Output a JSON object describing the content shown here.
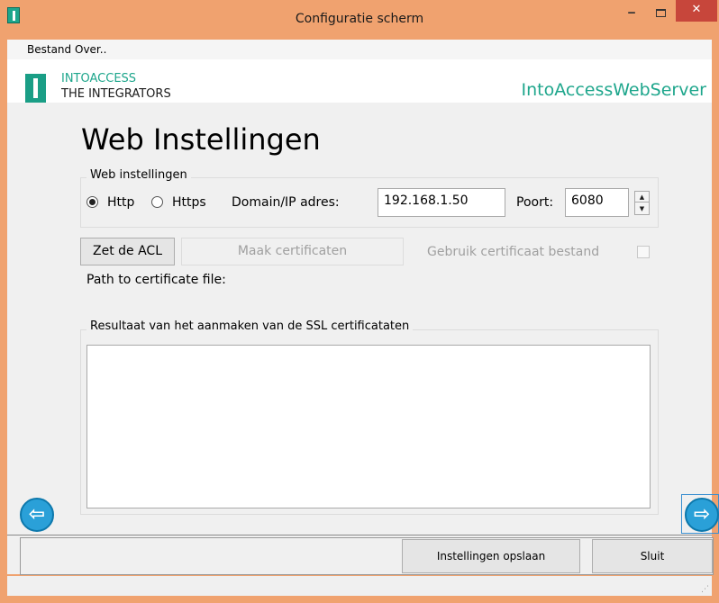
{
  "window": {
    "title": "Configuratie scherm",
    "accent_color": "#f0a26f",
    "close_color": "#c7463b",
    "min_symbol": "‒",
    "close_symbol": "✕"
  },
  "menu": {
    "items": [
      {
        "label": "Bestand"
      },
      {
        "label": "Over.."
      }
    ]
  },
  "banner": {
    "logo_line1": "INTOACCESS",
    "logo_line2": "THE INTEGRATORS",
    "server_name": "IntoAccessWebServer",
    "brand_color": "#1ea68c"
  },
  "page": {
    "title": "Web Instellingen"
  },
  "web_settings": {
    "legend": "Web instellingen",
    "protocol_options": [
      {
        "label": "Http",
        "checked": true
      },
      {
        "label": "Https",
        "checked": false
      }
    ],
    "domain_label": "Domain/IP adres:",
    "domain_value": "192.168.1.50",
    "port_label": "Poort:",
    "port_value": "6080",
    "spin_up": "▲",
    "spin_down": "▼"
  },
  "actions": {
    "acl_label": "Zet de ACL",
    "cert_label": "Maak certificaten",
    "use_cert_label": "Gebruik certificaat bestand",
    "use_cert_checked": false,
    "path_label": "Path to certificate file:"
  },
  "result": {
    "legend": "Resultaat van het aanmaken van de SSL certificataten",
    "text": ""
  },
  "navigation": {
    "prev_symbol": "⇦",
    "next_symbol": "⇨"
  },
  "footer": {
    "save_label": "Instellingen opslaan",
    "close_label": "Sluit"
  },
  "statusbar": {
    "grip_symbol": "⋰"
  }
}
